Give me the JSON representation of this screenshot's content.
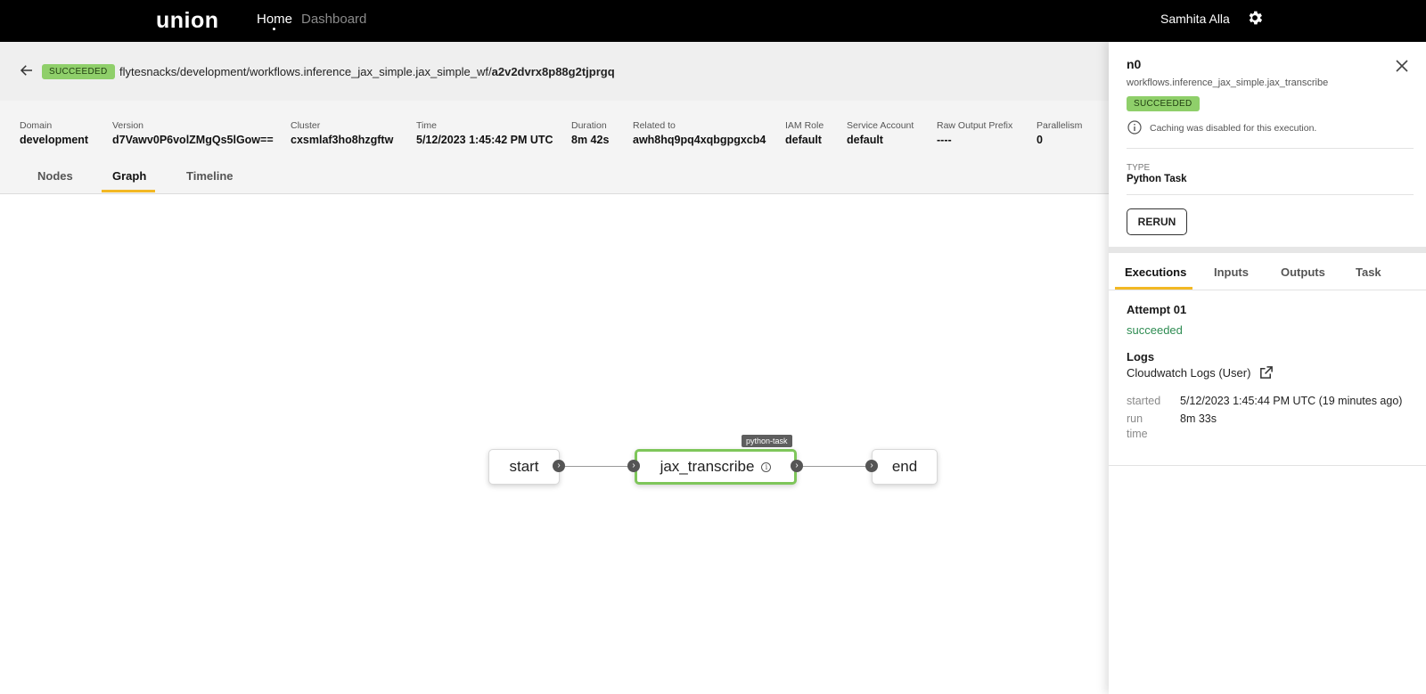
{
  "topbar": {
    "logo": "union",
    "nav": {
      "home": "Home",
      "dashboard": "Dashboard"
    },
    "user": "Samhita Alla",
    "settings_icon": "gear-icon"
  },
  "header": {
    "status": "SUCCEEDED",
    "breadcrumb_prefix": "flytesnacks/development/workflows.inference_jax_simple.jax_simple_wf/",
    "execution_id": "a2v2dvrx8p88g2tjprgq"
  },
  "metadata": [
    {
      "label": "Domain",
      "value": "development"
    },
    {
      "label": "Version",
      "value": "d7Vawv0P6volZMgQs5lGow=="
    },
    {
      "label": "Cluster",
      "value": "cxsmlaf3ho8hzgftw"
    },
    {
      "label": "Time",
      "value": "5/12/2023 1:45:42 PM UTC"
    },
    {
      "label": "Duration",
      "value": "8m 42s"
    },
    {
      "label": "Related to",
      "value": "awh8hq9pq4xqbgpgxcb4"
    },
    {
      "label": "IAM Role",
      "value": "default"
    },
    {
      "label": "Service Account",
      "value": "default"
    },
    {
      "label": "Raw Output Prefix",
      "value": "----"
    },
    {
      "label": "Parallelism",
      "value": "0"
    }
  ],
  "tabs": [
    "Nodes",
    "Graph",
    "Timeline"
  ],
  "active_tab": "Graph",
  "graph": {
    "nodes": [
      {
        "label": "start"
      },
      {
        "label": "jax_transcribe",
        "tag": "python-task"
      },
      {
        "label": "end"
      }
    ]
  },
  "panel": {
    "title": "n0",
    "subtitle": "workflows.inference_jax_simple.jax_transcribe",
    "status": "SUCCEEDED",
    "cache_note": "Caching was disabled for this execution.",
    "type_label": "TYPE",
    "type_value": "Python Task",
    "rerun_label": "RERUN",
    "tabs": [
      "Executions",
      "Inputs",
      "Outputs",
      "Task"
    ],
    "active_tab": "Executions",
    "attempt": "Attempt 01",
    "attempt_status": "succeeded",
    "logs_label": "Logs",
    "log_link": "Cloudwatch Logs (User)",
    "started_label": "started",
    "started_value": "5/12/2023 1:45:44 PM UTC (19 minutes ago)",
    "runtime_label_1": "run",
    "runtime_label_2": "time",
    "runtime_value": "8m 33s"
  },
  "colors": {
    "accent": "#f2b824",
    "success_badge": "#8fcf6a",
    "success_text": "#2e8c52",
    "node_active": "#7ec65a"
  }
}
